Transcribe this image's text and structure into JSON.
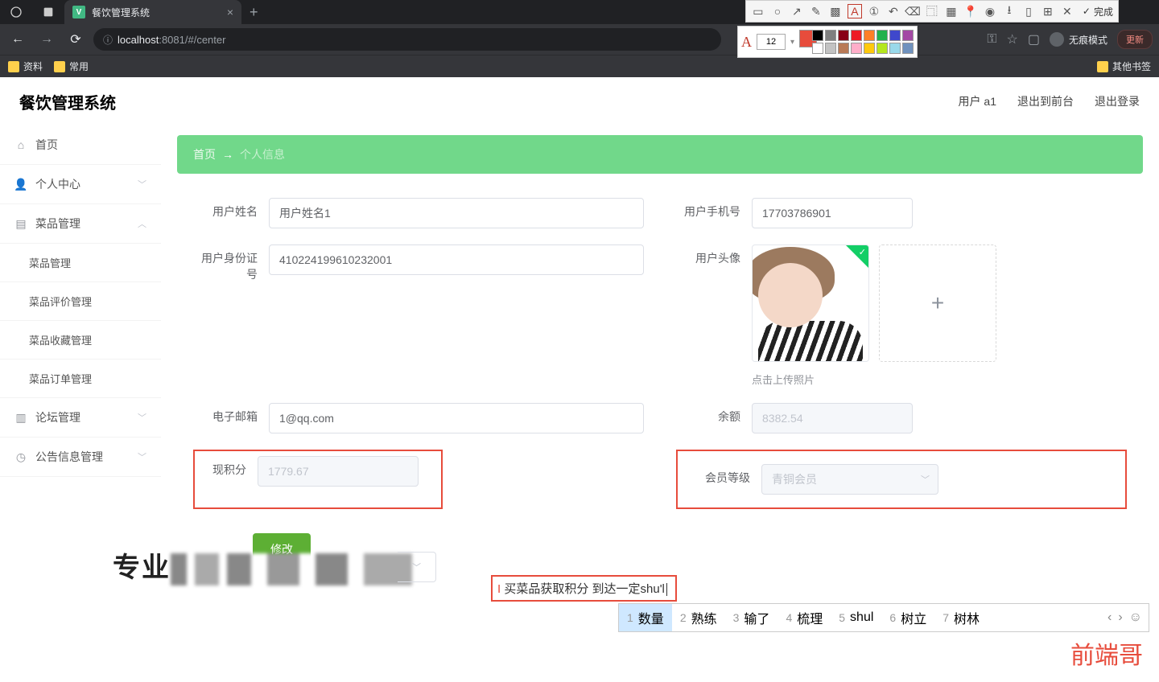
{
  "browser": {
    "tab_title": "餐饮管理系统",
    "url_host": "localhost",
    "url_port": ":8081",
    "url_path": "/#/center",
    "bookmarks": {
      "b1": "资料",
      "b2": "常用",
      "other": "其他书签"
    },
    "incognito": "无痕模式",
    "update": "更新"
  },
  "annot": {
    "done": "完成",
    "font_size": "12"
  },
  "app": {
    "title": "餐饮管理系统",
    "header": {
      "user": "用户 a1",
      "logout_front": "退出到前台",
      "logout": "退出登录"
    },
    "sidebar": {
      "home": "首页",
      "personal": "个人中心",
      "dish_mgmt": "菜品管理",
      "sub_dish": "菜品管理",
      "sub_review": "菜品评价管理",
      "sub_fav": "菜品收藏管理",
      "sub_order": "菜品订单管理",
      "forum": "论坛管理",
      "notice": "公告信息管理"
    },
    "breadcrumb": {
      "home": "首页",
      "arrow": "→",
      "current": "个人信息"
    },
    "form": {
      "name_label": "用户姓名",
      "name_value": "用户姓名1",
      "phone_label": "用户手机号",
      "phone_value": "17703786901",
      "id_label": "用户身份证号",
      "id_value": "410224199610232001",
      "avatar_label": "用户头像",
      "upload_hint": "点击上传照片",
      "email_label": "电子邮箱",
      "email_value": "1@qq.com",
      "balance_label": "余额",
      "balance_value": "8382.54",
      "points_label": "现积分",
      "points_value": "1779.67",
      "level_label": "会员等级",
      "level_value": "青铜会员",
      "submit": "修改"
    }
  },
  "overlay": {
    "pixel_prefix": "专业",
    "note_text": "买菜品获取积分 到达一定shu'l",
    "ime": {
      "o1": "数量",
      "o2": "熟练",
      "o3": "输了",
      "o4": "梳理",
      "o5": "shul",
      "o6": "树立",
      "o7": "树林"
    },
    "watermark": "前端哥"
  }
}
